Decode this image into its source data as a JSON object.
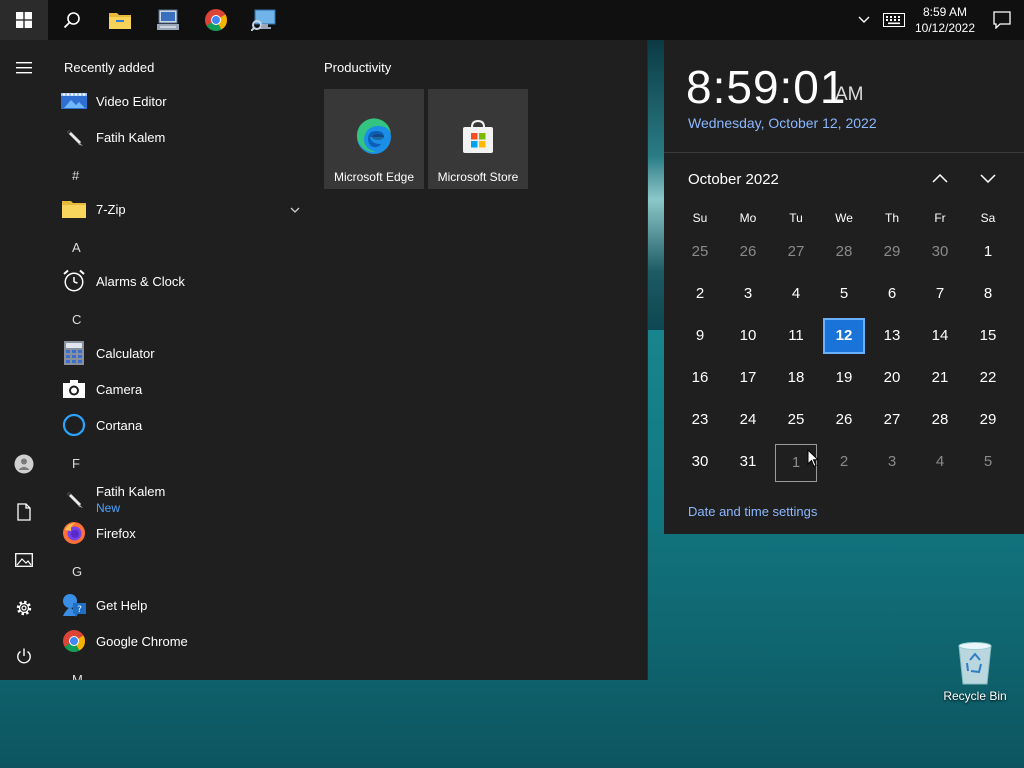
{
  "taskbar": {
    "clock_time": "8:59 AM",
    "clock_date": "10/12/2022",
    "pinned": [
      "search-icon",
      "file-explorer-icon",
      "network-tool-icon",
      "chrome-icon",
      "remote-desktop-icon"
    ]
  },
  "start_menu": {
    "recently_added_title": "Recently added",
    "apps": [
      {
        "label": "Video Editor",
        "icon": "video-editor-icon"
      },
      {
        "label": "Fatih Kalem",
        "icon": "pen-icon"
      },
      {
        "label": "7-Zip",
        "icon": "folder-icon"
      },
      {
        "label": "Alarms & Clock",
        "icon": "alarm-clock-icon"
      },
      {
        "label": "Calculator",
        "icon": "calculator-icon"
      },
      {
        "label": "Camera",
        "icon": "camera-icon"
      },
      {
        "label": "Cortana",
        "icon": "cortana-icon"
      },
      {
        "label": "Fatih Kalem",
        "sub": "New",
        "icon": "pen-icon"
      },
      {
        "label": "Firefox",
        "icon": "firefox-icon"
      },
      {
        "label": "Get Help",
        "icon": "help-icon"
      },
      {
        "label": "Google Chrome",
        "icon": "chrome-icon"
      }
    ],
    "letters": [
      "#",
      "A",
      "C",
      "F",
      "G",
      "M"
    ],
    "tile_group": "Productivity",
    "tiles": [
      {
        "label": "Microsoft Edge",
        "icon": "edge-icon"
      },
      {
        "label": "Microsoft Store",
        "icon": "store-icon"
      }
    ]
  },
  "calendar": {
    "time": "8:59:01",
    "ampm": "AM",
    "full_date": "Wednesday, October 12, 2022",
    "month_label": "October 2022",
    "weekdays": [
      "Su",
      "Mo",
      "Tu",
      "We",
      "Th",
      "Fr",
      "Sa"
    ],
    "weeks": [
      [
        "25",
        "26",
        "27",
        "28",
        "29",
        "30",
        "1"
      ],
      [
        "2",
        "3",
        "4",
        "5",
        "6",
        "7",
        "8"
      ],
      [
        "9",
        "10",
        "11",
        "12",
        "13",
        "14",
        "15"
      ],
      [
        "16",
        "17",
        "18",
        "19",
        "20",
        "21",
        "22"
      ],
      [
        "23",
        "24",
        "25",
        "26",
        "27",
        "28",
        "29"
      ],
      [
        "30",
        "31",
        "1",
        "2",
        "3",
        "4",
        "5"
      ]
    ],
    "today": "12",
    "settings_link": "Date and time settings"
  },
  "desktop": {
    "recycle_bin": "Recycle Bin"
  },
  "colors": {
    "accent": "#1a73d9",
    "link": "#8cb8ff",
    "panel": "#1f1f1f",
    "taskbar": "#101010"
  }
}
